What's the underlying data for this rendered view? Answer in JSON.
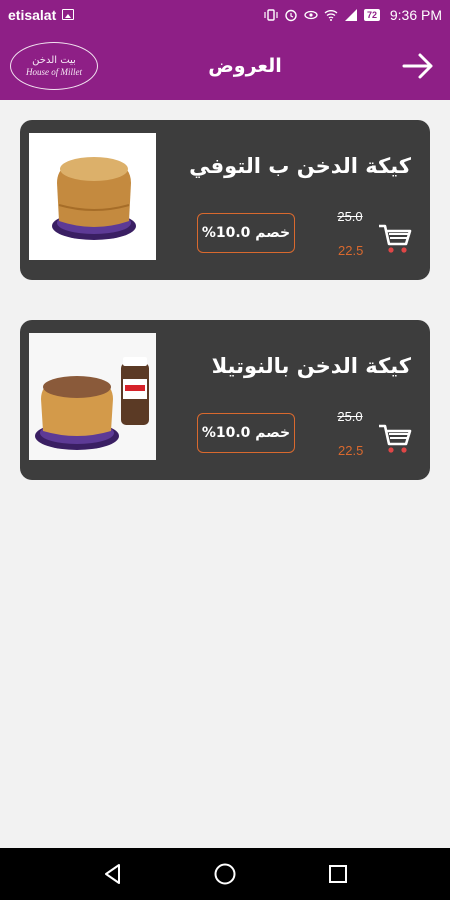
{
  "status_bar": {
    "carrier": "etisalat",
    "battery": "72",
    "time": "9:36 PM"
  },
  "app_bar": {
    "title": "العروض",
    "logo_ar": "بيت الدخن",
    "logo_en": "House of Millet",
    "back_icon": "arrow-right-icon"
  },
  "offers": [
    {
      "name": "كيكة الدخن ب التوفي",
      "discount": "خصم 10.0%",
      "old_price": "25.0",
      "new_price": "22.5",
      "cart_icon": "cart-icon"
    },
    {
      "name": "كيكة الدخن بالنوتيلا",
      "discount": "خصم 10.0%",
      "old_price": "25.0",
      "new_price": "22.5",
      "cart_icon": "cart-icon"
    }
  ],
  "nav": {
    "back_icon": "triangle-back-icon",
    "home_icon": "circle-home-icon",
    "recent_icon": "square-recents-icon"
  },
  "colors": {
    "brand": "#8e1f86",
    "card": "#3d3d3d",
    "accent": "#d9692e",
    "background": "#f2f2f2"
  }
}
